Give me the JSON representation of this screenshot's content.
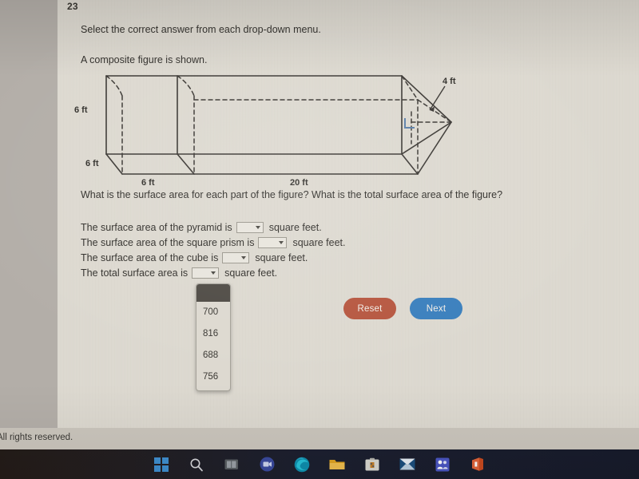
{
  "question": {
    "number": "23",
    "instruction": "Select the correct answer from each drop-down menu.",
    "figure_intro": "A composite figure is shown.",
    "prompt": "What is the surface area for each part of the figure? What is the total surface area of the figure?"
  },
  "figure": {
    "labels": {
      "cube_height": "6 ft",
      "cube_depth": "6 ft",
      "cube_width": "6 ft",
      "prism_length": "20 ft",
      "pyramid_slant": "4 ft"
    }
  },
  "statements": [
    {
      "lead": "The surface area of the pyramid is",
      "value": "",
      "tail": "square feet."
    },
    {
      "lead": "The surface area of the square prism is",
      "value": "",
      "tail": "square feet."
    },
    {
      "lead": "The surface area of the cube is",
      "value": "",
      "tail": "square feet."
    },
    {
      "lead": "The total surface area is",
      "value": "",
      "tail": "square feet."
    }
  ],
  "dropdown": {
    "open": true,
    "selected": "",
    "options": [
      "700",
      "816",
      "688",
      "756"
    ]
  },
  "buttons": {
    "reset": "Reset",
    "next": "Next"
  },
  "footer": {
    "text": "All rights reserved."
  },
  "taskbar": {
    "icons": [
      "windows-start-icon",
      "search-icon",
      "task-view-icon",
      "teams-chat-icon",
      "edge-browser-icon",
      "file-explorer-icon",
      "microsoft-store-icon",
      "mail-icon",
      "teams-icon",
      "office-icon"
    ]
  },
  "colors": {
    "page_background": "#dedad1",
    "reset_button": "#b6563f",
    "next_button": "#3a7fbd",
    "taskbar": "#1c2030",
    "figure_line": "#3a3733",
    "right_angle_marker": "#5b7fa8"
  }
}
